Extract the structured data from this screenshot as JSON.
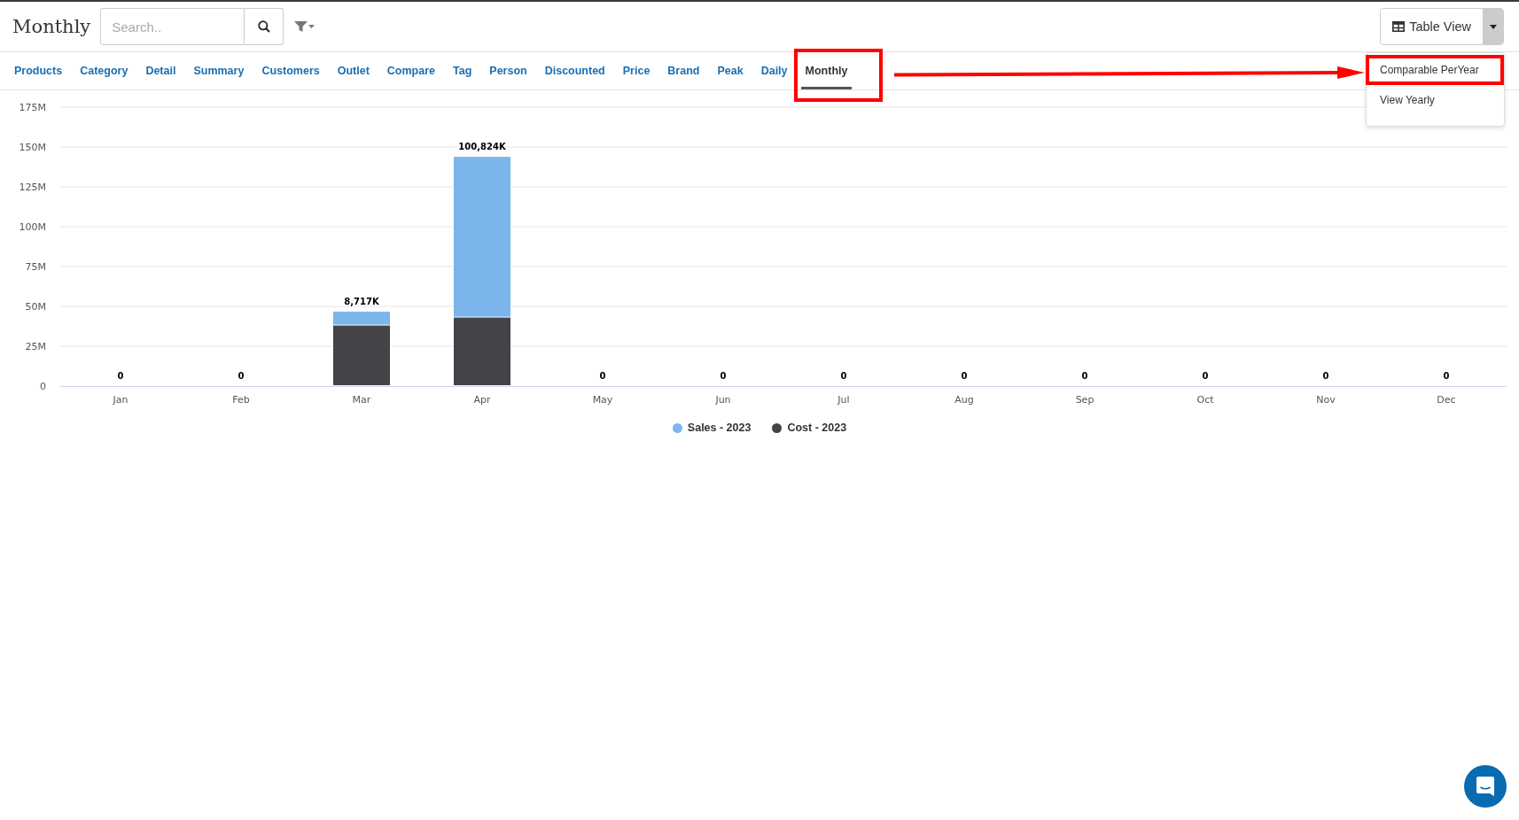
{
  "header": {
    "title": "Monthly",
    "search": {
      "placeholder": "Search.."
    },
    "view_button": {
      "label": "Table View"
    }
  },
  "tabs": [
    {
      "label": "Products",
      "selected": false,
      "highlighted": false
    },
    {
      "label": "Category",
      "selected": false,
      "highlighted": false
    },
    {
      "label": "Detail",
      "selected": false,
      "highlighted": false
    },
    {
      "label": "Summary",
      "selected": false,
      "highlighted": false
    },
    {
      "label": "Customers",
      "selected": false,
      "highlighted": false
    },
    {
      "label": "Outlet",
      "selected": false,
      "highlighted": false
    },
    {
      "label": "Compare",
      "selected": false,
      "highlighted": false
    },
    {
      "label": "Tag",
      "selected": false,
      "highlighted": false
    },
    {
      "label": "Person",
      "selected": false,
      "highlighted": false
    },
    {
      "label": "Discounted",
      "selected": false,
      "highlighted": false
    },
    {
      "label": "Price",
      "selected": false,
      "highlighted": false
    },
    {
      "label": "Brand",
      "selected": false,
      "highlighted": false
    },
    {
      "label": "Peak",
      "selected": false,
      "highlighted": false
    },
    {
      "label": "Daily",
      "selected": false,
      "highlighted": false
    },
    {
      "label": "Monthly",
      "selected": true,
      "highlighted": true
    }
  ],
  "view_menu": {
    "expanded": true,
    "items": [
      {
        "label": "Comparable PerYear",
        "highlighted": true
      },
      {
        "label": "View Yearly",
        "highlighted": false
      }
    ]
  },
  "callout_arrow": true,
  "chart": {
    "chart_data": {
      "type": "bar",
      "stacked": true,
      "categories": [
        "Jan",
        "Feb",
        "Mar",
        "Apr",
        "May",
        "Jun",
        "Jul",
        "Aug",
        "Sep",
        "Oct",
        "Nov",
        "Dec"
      ],
      "series": [
        {
          "name": "Sales - 2023",
          "color": "#7cb5ec",
          "values": [
            0,
            0,
            8.717,
            100.824,
            0,
            0,
            0,
            0,
            0,
            0,
            0,
            0
          ]
        },
        {
          "name": "Cost - 2023",
          "color": "#434348",
          "values": [
            0,
            0,
            38,
            43,
            0,
            0,
            0,
            0,
            0,
            0,
            0,
            0
          ]
        }
      ],
      "grid": true,
      "legend": true,
      "ylim": [
        0,
        175
      ],
      "yticks": [
        {
          "value": 0,
          "label": "0"
        },
        {
          "value": 25,
          "label": "25M"
        },
        {
          "value": 50,
          "label": "50M"
        },
        {
          "value": 75,
          "label": "75M"
        },
        {
          "value": 100,
          "label": "100M"
        },
        {
          "value": 125,
          "label": "125M"
        },
        {
          "value": 150,
          "label": "150M"
        },
        {
          "value": 175,
          "label": "175M"
        }
      ],
      "value_labels": [
        "0",
        "0",
        "8,717K",
        "100,824K",
        "0",
        "0",
        "0",
        "0",
        "0",
        "0",
        "0",
        "0"
      ]
    }
  }
}
